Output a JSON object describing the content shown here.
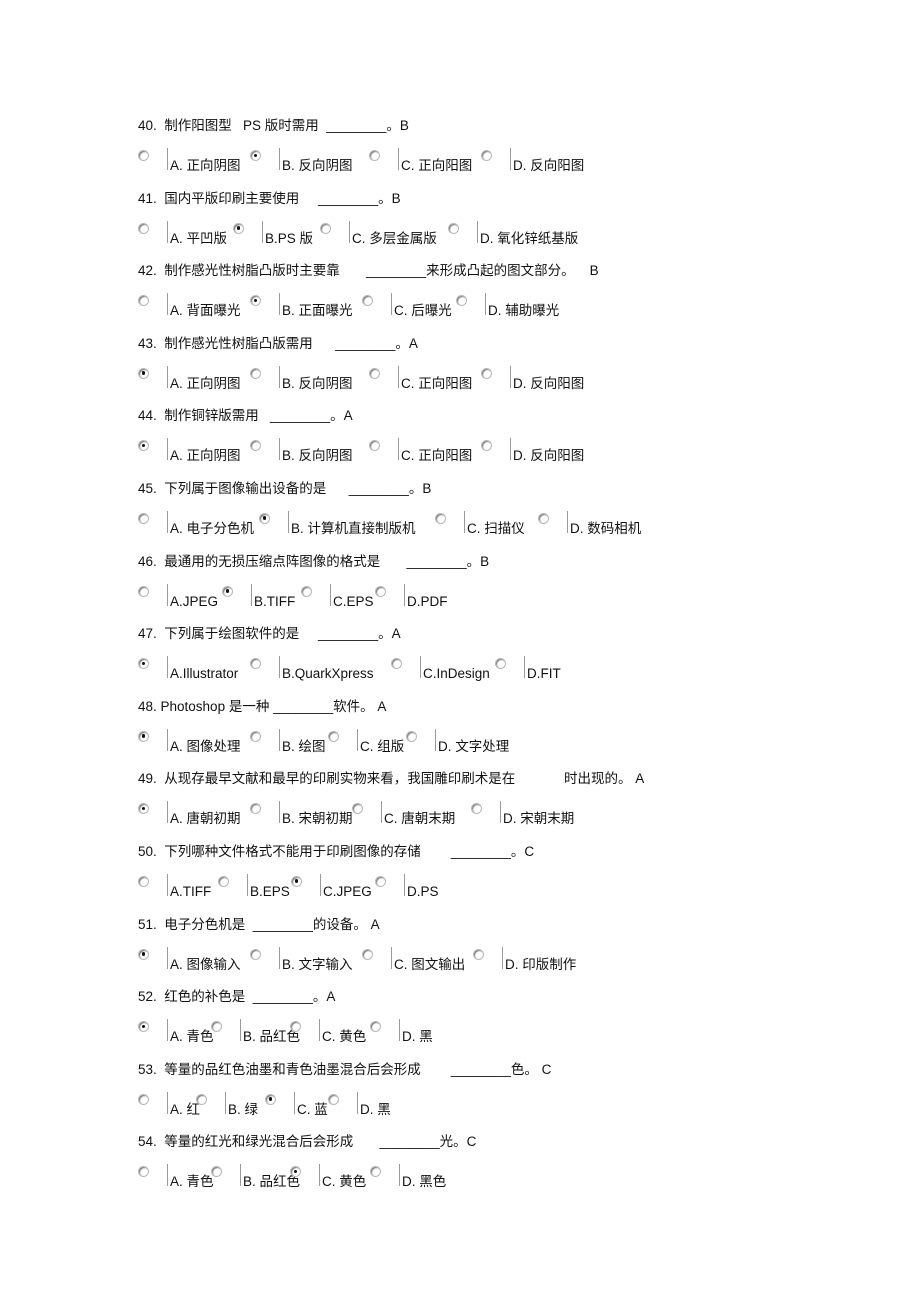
{
  "questions": [
    {
      "number": "40.",
      "stem": "40.  制作阳图型   PS 版时需用  ________。B",
      "answer": "B",
      "options": [
        "A. 正向阴图",
        "B. 反向阴图",
        "C. 正向阳图",
        "D. 反向阳图"
      ],
      "selected": 1
    },
    {
      "number": "41.",
      "stem": "41.  国内平版印刷主要使用     ________。B",
      "answer": "B",
      "options": [
        "A. 平凹版",
        "B.PS 版",
        "C. 多层金属版",
        "D. 氧化锌纸基版"
      ],
      "selected": 1
    },
    {
      "number": "42.",
      "stem": "42.  制作感光性树脂凸版时主要靠       ________来形成凸起的图文部分。    B",
      "answer": "B",
      "options": [
        "A. 背面曝光",
        "B. 正面曝光",
        "C. 后曝光",
        "D. 辅助曝光"
      ],
      "selected": 1
    },
    {
      "number": "43.",
      "stem": "43.  制作感光性树脂凸版需用      ________。A",
      "answer": "A",
      "options": [
        "A. 正向阴图",
        "B. 反向阴图",
        "C. 正向阳图",
        "D. 反向阳图"
      ],
      "selected": 0
    },
    {
      "number": "44.",
      "stem": "44.  制作铜锌版需用   ________。A",
      "answer": "A",
      "options": [
        "A. 正向阴图",
        "B. 反向阴图",
        "C. 正向阳图",
        "D. 反向阳图"
      ],
      "selected": 0
    },
    {
      "number": "45.",
      "stem": "45.  下列属于图像输出设备的是      ________。B",
      "answer": "B",
      "options": [
        "A. 电子分色机",
        "B. 计算机直接制版机",
        "C. 扫描仪",
        "D. 数码相机"
      ],
      "selected": 1
    },
    {
      "number": "46.",
      "stem": "46.  最通用的无损压缩点阵图像的格式是       ________。B",
      "answer": "B",
      "options": [
        "A.JPEG",
        "B.TIFF",
        "C.EPS",
        "D.PDF"
      ],
      "selected": 1
    },
    {
      "number": "47.",
      "stem": "47.  下列属于绘图软件的是     ________。A",
      "answer": "A",
      "options": [
        "A.Illustrator",
        "B.QuarkXpress",
        "C.InDesign",
        "D.FIT"
      ],
      "selected": 0
    },
    {
      "number": "48.",
      "stem": "48. Photoshop 是一种 ________软件。 A",
      "answer": "A",
      "options": [
        "A. 图像处理",
        "B. 绘图",
        "C. 组版",
        "D. 文字处理"
      ],
      "selected": 0
    },
    {
      "number": "49.",
      "stem": "49.  从现存最早文献和最早的印刷实物来看，我国雕印刷术是在             时出现的。 A",
      "answer": "A",
      "options": [
        "A. 唐朝初期",
        "B. 宋朝初期",
        "C. 唐朝末期",
        "D. 宋朝末期"
      ],
      "selected": 0
    },
    {
      "number": "50.",
      "stem": "50.  下列哪种文件格式不能用于印刷图像的存储        ________。C",
      "answer": "C",
      "options": [
        "A.TIFF",
        "B.EPS",
        "C.JPEG",
        "D.PS"
      ],
      "selected": 2
    },
    {
      "number": "51.",
      "stem": "51.  电子分色机是  ________的设备。 A",
      "answer": "A",
      "options": [
        "A. 图像输入",
        "B. 文字输入",
        "C. 图文输出",
        "D. 印版制作"
      ],
      "selected": 0
    },
    {
      "number": "52.",
      "stem": "52.  红色的补色是  ________。A",
      "answer": "A",
      "options": [
        "A. 青色",
        "B. 品红色",
        "C. 黄色",
        "D. 黑"
      ],
      "selected": 0
    },
    {
      "number": "53.",
      "stem": "53.  等量的品红色油墨和青色油墨混合后会形成        ________色。 C",
      "answer": "C",
      "options": [
        "A. 红",
        "B. 绿",
        "C. 蓝",
        "D. 黑"
      ],
      "selected": 2
    },
    {
      "number": "54.",
      "stem": "54.  等量的红光和绿光混合后会形成       ________光。C",
      "answer": "C",
      "options": [
        "A. 青色",
        "B. 品红色",
        "C. 黄色",
        "D. 黑色"
      ],
      "selected": 2
    }
  ]
}
